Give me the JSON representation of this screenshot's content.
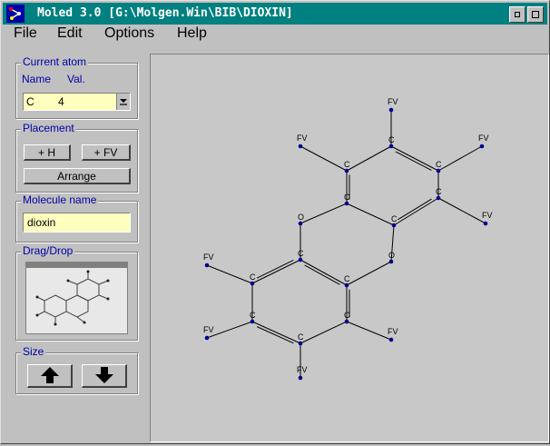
{
  "window": {
    "title": "Moled 3.0 [G:\\Molgen.Win\\BIB\\DIOXIN]"
  },
  "menu": [
    {
      "label": "File"
    },
    {
      "label": "Edit"
    },
    {
      "label": "Options"
    },
    {
      "label": "Help"
    }
  ],
  "current_atom": {
    "title": "Current atom",
    "name_label": "Name",
    "val_label": "Val.",
    "selected_atom": "C",
    "selected_valence": "4"
  },
  "placement": {
    "title": "Placement",
    "add_h_label": "+ H",
    "add_fv_label": "+ FV",
    "arrange_label": "Arrange"
  },
  "molecule_name": {
    "title": "Molecule name",
    "value": "dioxin"
  },
  "drag_drop": {
    "title": "Drag/Drop"
  },
  "size": {
    "title": "Size"
  },
  "molecule": {
    "atoms": [
      "FV",
      "C",
      "C",
      "FV",
      "C",
      "C",
      "FV",
      "C",
      "C",
      "FV",
      "O",
      "O",
      "C",
      "C",
      "FV",
      "C",
      "C",
      "FV",
      "C",
      "C",
      "FV",
      "FV"
    ]
  },
  "colors": {
    "titlebar": "#008080",
    "label": "#0000a8",
    "atom_dot": "#00008b",
    "field": "#ffffc0"
  }
}
